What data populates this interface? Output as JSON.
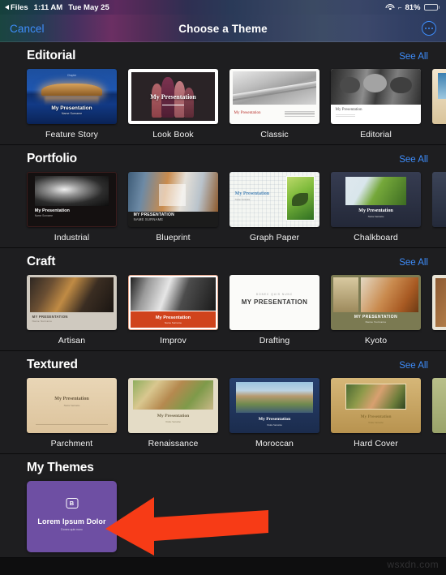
{
  "status_bar": {
    "back_app": "Files",
    "time": "1:11 AM",
    "date": "Tue May 25",
    "wifi_icon": "wifi-icon",
    "location_icon": "location-arrow-icon",
    "battery_percent": "81%",
    "battery_level": 81
  },
  "nav_bar": {
    "cancel_label": "Cancel",
    "title": "Choose a Theme",
    "more_icon": "ellipsis-circle-icon"
  },
  "see_all_label": "See All",
  "accent_color": "#3e8dfb",
  "background_color": "#1e1e20",
  "sections": [
    {
      "title": "Editorial",
      "themes": [
        {
          "name": "Feature Story",
          "art": "th-feature",
          "title_text": "My Presentation",
          "subtitle_text": "Name Surname",
          "kicker": "Chapter"
        },
        {
          "name": "Look Book",
          "art": "th-lookbook",
          "title_text": "My Presentation",
          "subtitle_text": ""
        },
        {
          "name": "Classic",
          "art": "th-classic",
          "title_text": "My Presentation",
          "subtitle_text": ""
        },
        {
          "name": "Editorial",
          "art": "th-editorial",
          "title_text": "My Presentation",
          "subtitle_text": ""
        }
      ],
      "partial_art": "th-partial-ed"
    },
    {
      "title": "Portfolio",
      "themes": [
        {
          "name": "Industrial",
          "art": "th-industrial",
          "title_text": "My Presentation",
          "subtitle_text": "Name Surname"
        },
        {
          "name": "Blueprint",
          "art": "th-blueprint",
          "title_text": "MY PRESENTATION",
          "subtitle_text": "NAME SURNAME"
        },
        {
          "name": "Graph Paper",
          "art": "th-graphpaper",
          "title_text": "My Presentation",
          "subtitle_text": "Name Surname"
        },
        {
          "name": "Chalkboard",
          "art": "th-chalkboard",
          "title_text": "My Presentation",
          "subtitle_text": "Name Surname"
        }
      ],
      "partial_art": "th-partial-port"
    },
    {
      "title": "Craft",
      "themes": [
        {
          "name": "Artisan",
          "art": "th-artisan",
          "title_text": "MY PRESENTATION",
          "subtitle_text": "Name Surname"
        },
        {
          "name": "Improv",
          "art": "th-improv",
          "title_text": "My Presentation",
          "subtitle_text": "Name Surname"
        },
        {
          "name": "Drafting",
          "art": "th-drafting",
          "title_text": "MY PRESENTATION",
          "subtitle_text": "",
          "kicker": "DONEC QUIS NUNC"
        },
        {
          "name": "Kyoto",
          "art": "th-kyoto",
          "title_text": "MY PRESENTATION",
          "subtitle_text": "Name Surname"
        }
      ],
      "partial_art": "th-partial-craft"
    },
    {
      "title": "Textured",
      "themes": [
        {
          "name": "Parchment",
          "art": "th-parchment",
          "title_text": "My Presentation",
          "subtitle_text": "Name Surname"
        },
        {
          "name": "Renaissance",
          "art": "th-renaissance",
          "title_text": "My Presentation",
          "subtitle_text": "Name Surname"
        },
        {
          "name": "Moroccan",
          "art": "th-moroccan",
          "title_text": "My Presentation",
          "subtitle_text": "Name Surname"
        },
        {
          "name": "Hard Cover",
          "art": "th-hardcover",
          "title_text": "My Presentation",
          "subtitle_text": "Name Surname"
        }
      ],
      "partial_art": "th-partial-tex"
    }
  ],
  "my_themes": {
    "title": "My Themes",
    "items": [
      {
        "badge": "B",
        "title": "Lorem Ipsum Dolor",
        "subtitle": "Donec quis nunc",
        "color": "#6e4fa3"
      }
    ]
  },
  "annotation": {
    "arrow_icon": "left-arrow-annotation",
    "arrow_color": "#f73b16"
  },
  "watermark": "wsxdn.com"
}
